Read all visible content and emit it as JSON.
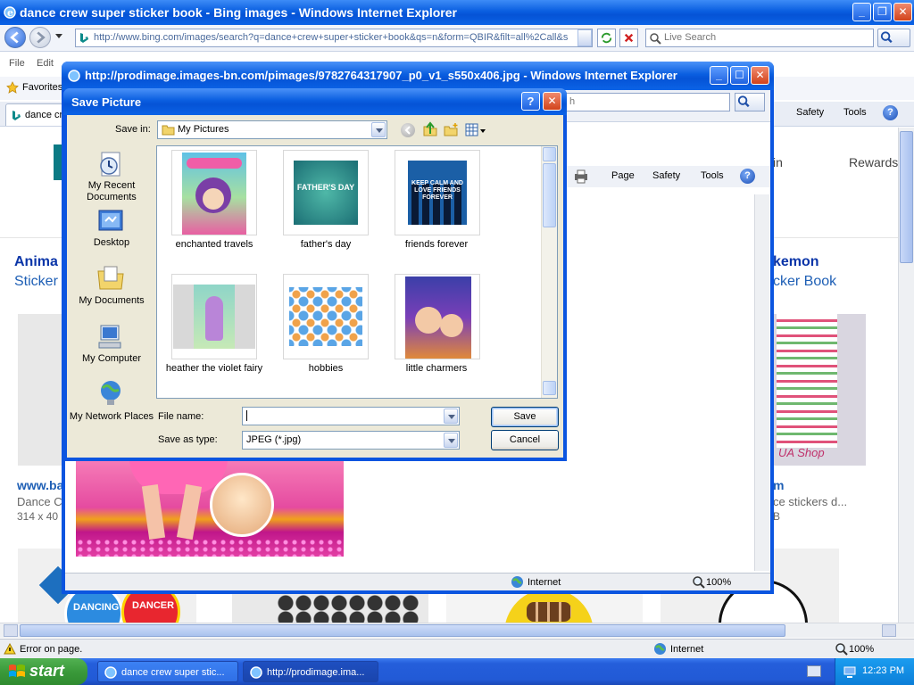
{
  "main_window": {
    "title": "dance crew super sticker book - Bing images - Windows Internet Explorer",
    "address": "http://www.bing.com/images/search?q=dance+crew+super+sticker+book&qs=n&form=QBIR&filt=all%2Call&s",
    "search_placeholder": "Live Search",
    "menu": [
      "File",
      "Edit"
    ],
    "favorites_label": "Favorites",
    "tab_label": "dance cr",
    "commands": {
      "safety": "Safety",
      "tools": "Tools"
    },
    "status": {
      "left": "Error on page.",
      "zone": "Internet",
      "zoom": "100%"
    }
  },
  "page": {
    "rewards": "in",
    "rewards_2": "Rewards",
    "left_result": {
      "title": "Anima",
      "subtitle": "Sticker",
      "link": "www.ba",
      "desc": "Dance C",
      "size": "314 x 40"
    },
    "right_result": {
      "title": "kemon",
      "subtitle": "cker Book",
      "link": "m",
      "desc": "ce stickers d...",
      "size": "B"
    },
    "sticker_labels": [
      "DANCING",
      "DANCER"
    ],
    "shop_text": "UA Shop"
  },
  "popup_window": {
    "title": "http://prodimage.images-bn.com/pimages/9782764317907_p0_v1_s550x406.jpg - Windows Internet Explorer",
    "commands": {
      "page": "Page",
      "safety": "Safety",
      "tools": "Tools"
    },
    "search_tail": "h",
    "status": {
      "zone": "Internet",
      "zoom": "100%"
    }
  },
  "dialog": {
    "title": "Save Picture",
    "save_in_label": "Save in:",
    "save_in_value": "My Pictures",
    "places": [
      {
        "label": "My Recent Documents",
        "icon": "recent-documents-icon"
      },
      {
        "label": "Desktop",
        "icon": "desktop-icon"
      },
      {
        "label": "My Documents",
        "icon": "my-documents-icon"
      },
      {
        "label": "My Computer",
        "icon": "my-computer-icon"
      },
      {
        "label": "My Network Places",
        "icon": "network-places-icon"
      }
    ],
    "files": [
      {
        "label": "enchanted travels"
      },
      {
        "label": "father's day",
        "thumb_text": "FATHER'S DAY"
      },
      {
        "label": "friends forever",
        "thumb_text": "KEEP CALM AND LOVE FRIENDS FOREVER"
      },
      {
        "label": "heather the violet fairy"
      },
      {
        "label": "hobbies"
      },
      {
        "label": "little charmers"
      }
    ],
    "file_name_label": "File name:",
    "file_name_value": "",
    "save_as_type_label": "Save as type:",
    "save_as_type_value": "JPEG (*.jpg)",
    "save_button": "Save",
    "cancel_button": "Cancel"
  },
  "taskbar": {
    "start_label": "start",
    "tasks": [
      "dance crew super stic...",
      "http://prodimage.ima..."
    ],
    "clock": "12:23 PM"
  },
  "colors": {
    "xp_blue": "#0a5ee0",
    "dialog_bg": "#ece9d8",
    "start_green": "#3a9a3a",
    "link_blue": "#0a35a8"
  }
}
